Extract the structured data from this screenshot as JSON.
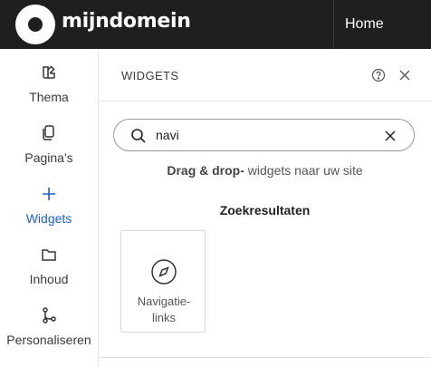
{
  "header": {
    "brand": "mijndomein",
    "home_label": "Home"
  },
  "sidebar": {
    "items": [
      {
        "label": "Thema",
        "icon": "palette-icon"
      },
      {
        "label": "Pagina's",
        "icon": "pages-icon"
      },
      {
        "label": "Widgets",
        "icon": "plus-icon",
        "active": true
      },
      {
        "label": "Inhoud",
        "icon": "folder-icon"
      },
      {
        "label": "Personaliseren",
        "icon": "branch-icon"
      }
    ]
  },
  "panel": {
    "title": "WIDGETS",
    "help_icon": "help-icon",
    "close_icon": "close-icon"
  },
  "search": {
    "value": "navi",
    "icon": "search-icon",
    "clear_icon": "clear-icon"
  },
  "hint": {
    "bold": "Drag & drop-",
    "text": " widgets naar uw site"
  },
  "results": {
    "title": "Zoekresultaten",
    "items": [
      {
        "label_line1": "Navigatie-",
        "label_line2": "links",
        "icon": "compass-icon"
      }
    ]
  },
  "colors": {
    "topbar": "#1f1f1f",
    "accent": "#1a5fd6"
  }
}
